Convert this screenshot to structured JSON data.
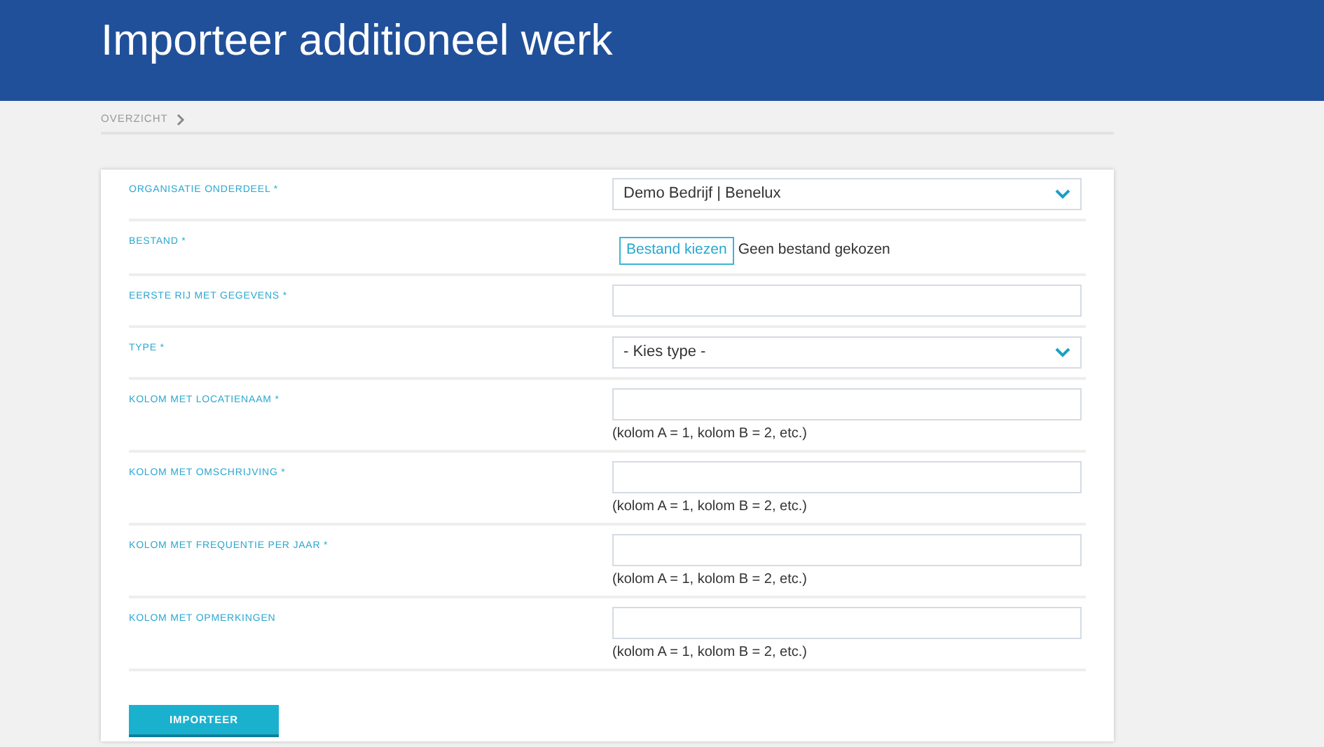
{
  "header": {
    "title": "Importeer additioneel werk"
  },
  "breadcrumb": [
    {
      "label": "OVERZICHT"
    }
  ],
  "form": {
    "fields": [
      {
        "label": "ORGANISATIE ONDERDEEL *",
        "kind": "select",
        "value": "Demo Bedrijf | Benelux"
      },
      {
        "label": "BESTAND *",
        "kind": "file",
        "button": "Bestand kiezen",
        "status": "Geen bestand gekozen"
      },
      {
        "label": "EERSTE RIJ MET GEGEVENS *",
        "kind": "text"
      },
      {
        "label": "TYPE *",
        "kind": "select",
        "value": "- Kies type -"
      },
      {
        "label": "KOLOM MET LOCATIENAAM *",
        "kind": "text",
        "hint": "(kolom A = 1, kolom B = 2, etc.)"
      },
      {
        "label": "KOLOM MET OMSCHRIJVING *",
        "kind": "text",
        "hint": "(kolom A = 1, kolom B = 2, etc.)"
      },
      {
        "label": "KOLOM MET FREQUENTIE PER JAAR *",
        "kind": "text",
        "hint": "(kolom A = 1, kolom B = 2, etc.)"
      },
      {
        "label": "KOLOM MET OPMERKINGEN",
        "kind": "text",
        "hint": "(kolom A = 1, kolom B = 2, etc.)"
      }
    ],
    "submit": "IMPORTEER"
  }
}
